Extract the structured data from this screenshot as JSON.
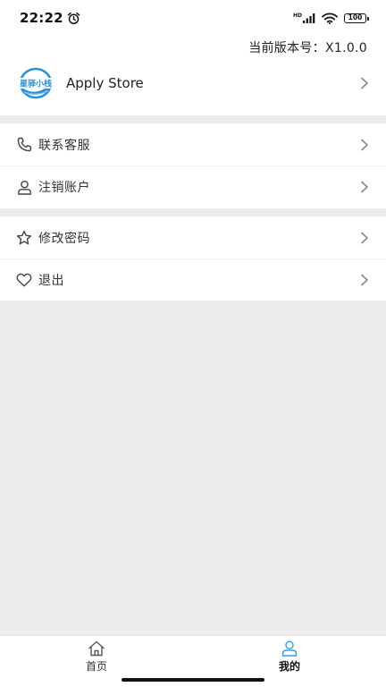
{
  "status_bar": {
    "time": "22:22",
    "network_label": "HD",
    "battery_level": "100",
    "icons": [
      "alarm-icon",
      "signal-icon",
      "wifi-icon",
      "battery-icon"
    ]
  },
  "header": {
    "version_text": "当前版本号：X1.0.0",
    "app_name": "Apply Store",
    "logo_text": "星驿小栈",
    "logo_color": "#2b8fd6"
  },
  "menu": {
    "group1": [
      {
        "label": "联系客服",
        "icon": "phone-icon"
      },
      {
        "label": "注销账户",
        "icon": "person-icon"
      }
    ],
    "group2": [
      {
        "label": "修改密码",
        "icon": "star-icon"
      },
      {
        "label": "退出",
        "icon": "heart-icon"
      }
    ]
  },
  "tabbar": {
    "tabs": [
      {
        "label": "首页",
        "icon": "home-icon",
        "active": false
      },
      {
        "label": "我的",
        "icon": "user-icon",
        "active": true
      }
    ],
    "active_color": "#3a9be0"
  }
}
